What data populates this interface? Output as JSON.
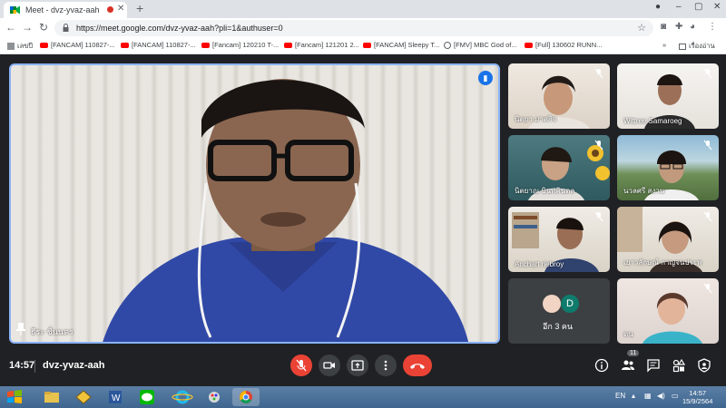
{
  "browser": {
    "tab_title": "Meet - dvz-yvaz-aah",
    "new_tab": "+",
    "url": "https://meet.google.com/dvz-yvaz-aah?pli=1&authuser=0",
    "colors": {
      "tab_bg": "#dee1e6",
      "rec": "#d93025"
    }
  },
  "bookmarks": [
    {
      "label": "เลขปี",
      "icon": "bookmark-icon"
    },
    {
      "label": "[FANCAM] 110827-...",
      "icon": "youtube-icon"
    },
    {
      "label": "[FANCAM] 110827-...",
      "icon": "youtube-icon"
    },
    {
      "label": "[Fancam] 120210 T-...",
      "icon": "youtube-icon"
    },
    {
      "label": "[Fancam] 121201 2...",
      "icon": "youtube-icon"
    },
    {
      "label": "[FANCAM] Sleepy T...",
      "icon": "youtube-icon"
    },
    {
      "label": "[FMV] MBC God of...",
      "icon": "globe-icon"
    },
    {
      "label": "[Full] 130602 RUNN...",
      "icon": "youtube-icon"
    }
  ],
  "bookmarks_more": "»",
  "reading_list": "เรื่องอ่าน",
  "meet": {
    "main_name": "ธีระ ชื่นนคร",
    "participants": [
      {
        "name": "นิตยา มาศกิจ",
        "bg": "room"
      },
      {
        "name": "Wittree Samaroeg",
        "bg": "white"
      },
      {
        "name": "นิตยาณ บินทคินดล",
        "bg": "teal"
      },
      {
        "name": "นวลศรี สงวน",
        "bg": "mountain"
      },
      {
        "name": "Anchart riebroy",
        "bg": "shelf"
      },
      {
        "name": "เยาวลักษณ์ กาญจนประพ",
        "bg": "shelf"
      },
      {
        "name": "ดน",
        "bg": "pink"
      }
    ],
    "more": {
      "label": "อีก 3 คน",
      "avatar_letter": "D"
    },
    "time": "14:57",
    "code": "dvz-yvaz-aah",
    "people_count": "11",
    "colors": {
      "accent": "#8ab4f8",
      "mute_red": "#ea4335",
      "dark": "#202124"
    }
  },
  "taskbar": {
    "lang": "EN",
    "clock_time": "14:57",
    "clock_date": "15/9/2564"
  }
}
